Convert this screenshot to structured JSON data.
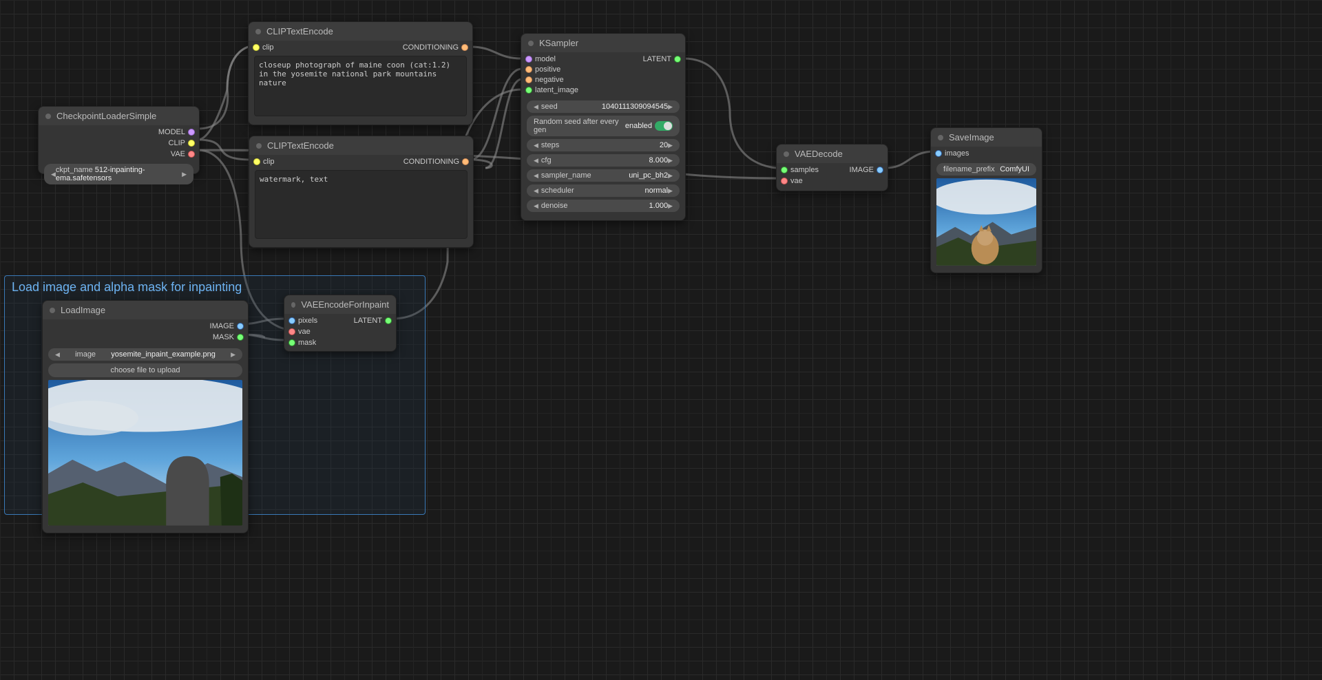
{
  "group": {
    "title": "Load image and alpha mask for inpainting"
  },
  "nodes": {
    "ckpt": {
      "title": "CheckpointLoaderSimple",
      "outputs": [
        "MODEL",
        "CLIP",
        "VAE"
      ],
      "param_label": "ckpt_name",
      "param_value": "512-inpainting-ema.safetensors"
    },
    "clip1": {
      "title": "CLIPTextEncode",
      "input": "clip",
      "output": "CONDITIONING",
      "text": "closeup photograph of maine coon (cat:1.2) in the yosemite national park mountains nature"
    },
    "clip2": {
      "title": "CLIPTextEncode",
      "input": "clip",
      "output": "CONDITIONING",
      "text": "watermark, text"
    },
    "ksampler": {
      "title": "KSampler",
      "inputs": [
        "model",
        "positive",
        "negative",
        "latent_image"
      ],
      "output": "LATENT",
      "rand_label": "Random seed after every gen",
      "rand_value": "enabled",
      "params": [
        {
          "label": "seed",
          "value": "1040111309094545"
        },
        {
          "label": "steps",
          "value": "20"
        },
        {
          "label": "cfg",
          "value": "8.000"
        },
        {
          "label": "sampler_name",
          "value": "uni_pc_bh2"
        },
        {
          "label": "scheduler",
          "value": "normal"
        },
        {
          "label": "denoise",
          "value": "1.000"
        }
      ]
    },
    "vaedec": {
      "title": "VAEDecode",
      "inputs": [
        "samples",
        "vae"
      ],
      "output": "IMAGE"
    },
    "save": {
      "title": "SaveImage",
      "input": "images",
      "param_label": "filename_prefix",
      "param_value": "ComfyUI"
    },
    "load": {
      "title": "LoadImage",
      "outputs": [
        "IMAGE",
        "MASK"
      ],
      "param_label": "image",
      "param_value": "yosemite_inpaint_example.png",
      "button": "choose file to upload"
    },
    "vaeenc": {
      "title": "VAEEncodeForInpaint",
      "inputs": [
        "pixels",
        "vae",
        "mask"
      ],
      "output": "LATENT"
    }
  }
}
